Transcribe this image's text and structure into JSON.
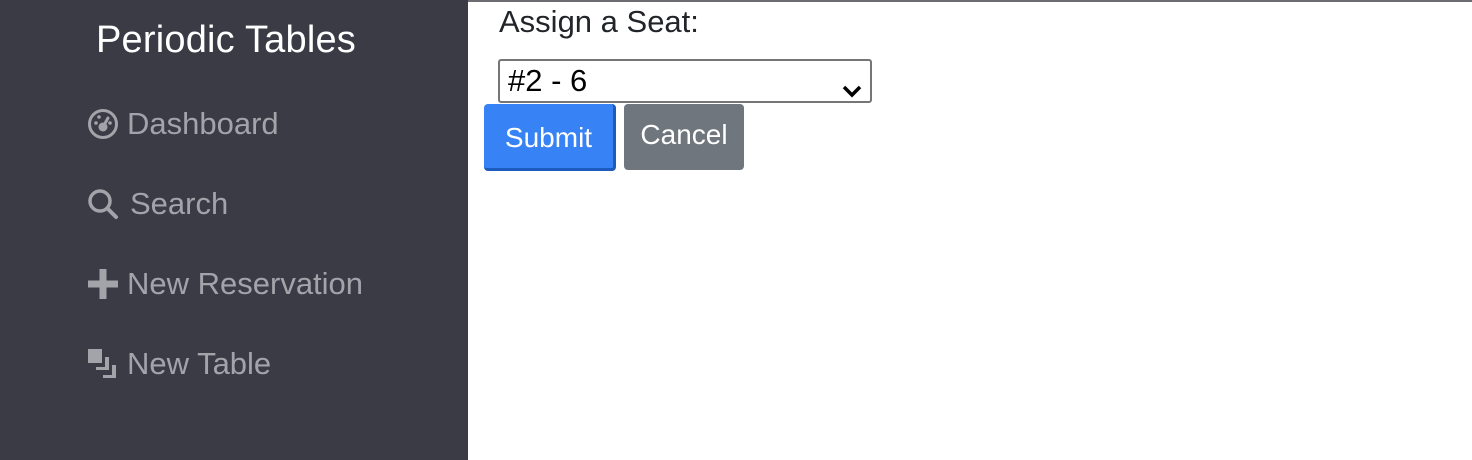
{
  "sidebar": {
    "brand": "Periodic Tables",
    "items": [
      {
        "label": "Dashboard",
        "icon": "dashboard-icon"
      },
      {
        "label": "Search",
        "icon": "search-icon"
      },
      {
        "label": "New Reservation",
        "icon": "plus-icon"
      },
      {
        "label": "New Table",
        "icon": "layers-icon"
      }
    ]
  },
  "form": {
    "label": "Assign a Seat:",
    "selected_value": "#2 - 6",
    "submit_label": "Submit",
    "cancel_label": "Cancel"
  },
  "colors": {
    "sidebar_bg": "#3b3b46",
    "nav_text": "#a3a3aa",
    "submit_bg": "#3782f5",
    "cancel_bg": "#70767d"
  }
}
